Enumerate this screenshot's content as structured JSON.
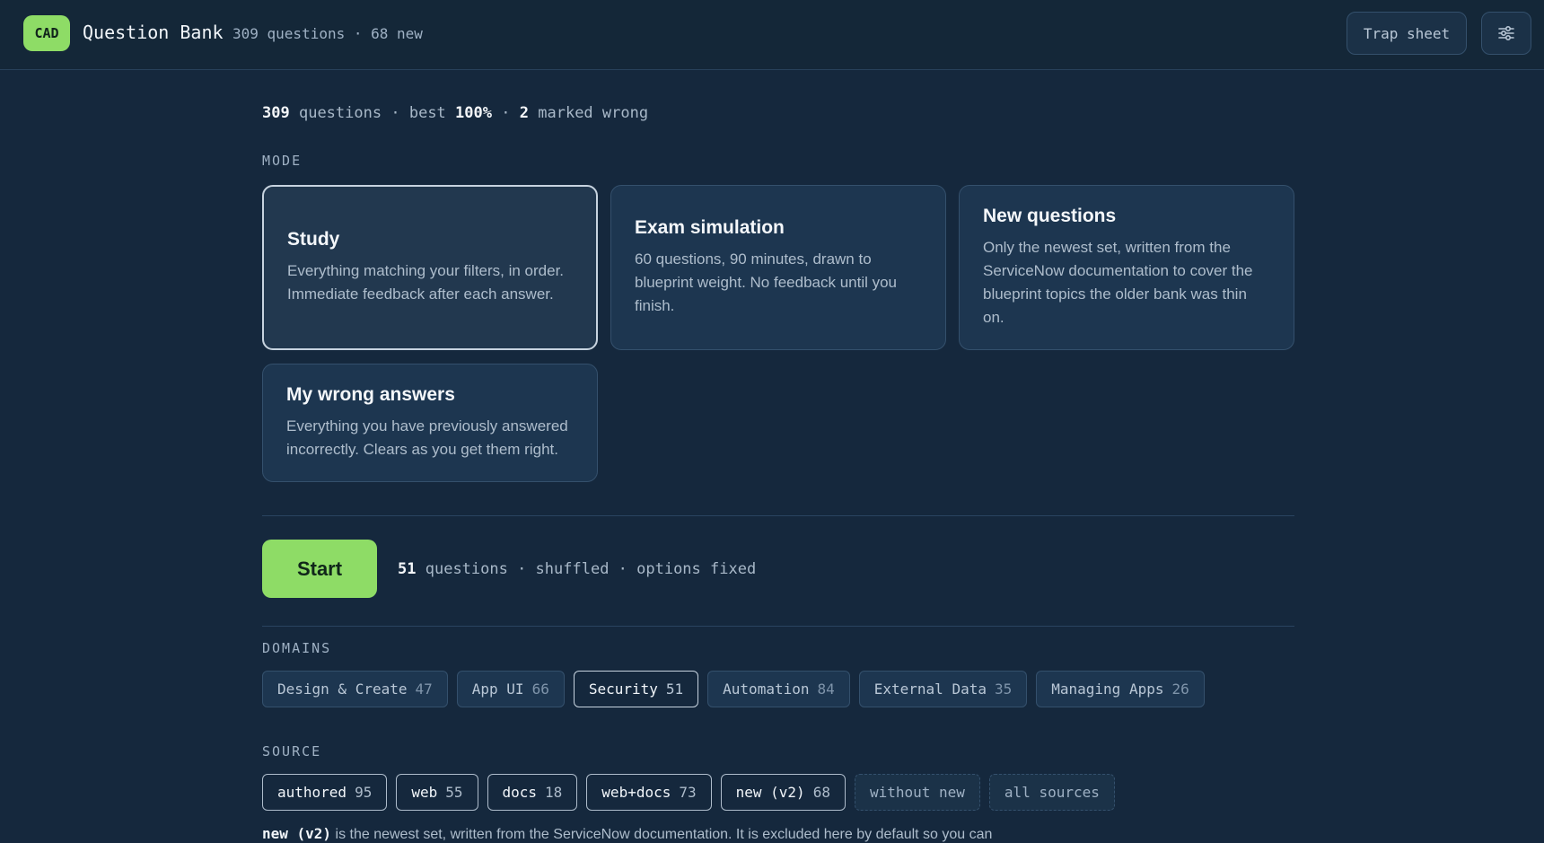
{
  "header": {
    "logo": "CAD",
    "title": "Question Bank",
    "subtitle": "309 questions · 68 new",
    "trap_sheet": "Trap sheet",
    "settings_icon": "sliders-icon"
  },
  "stats": {
    "questions_count": "309",
    "questions_label": "questions",
    "sep1": "·",
    "best_label": "best",
    "best_value": "100%",
    "sep2": "·",
    "wrong_count": "2",
    "wrong_label": "marked wrong"
  },
  "mode": {
    "label": "MODE",
    "cards": [
      {
        "title": "Study",
        "desc": "Everything matching your filters, in order. Immediate feedback after each answer.",
        "selected": true
      },
      {
        "title": "Exam simulation",
        "desc": "60 questions, 90 minutes, drawn to blueprint weight. No feedback until you finish.",
        "selected": false
      },
      {
        "title": "New questions",
        "desc": "Only the newest set, written from the ServiceNow documentation to cover the blueprint topics the older bank was thin on.",
        "selected": false
      },
      {
        "title": "My wrong answers",
        "desc": "Everything you have previously answered incorrectly. Clears as you get them right.",
        "selected": false
      }
    ]
  },
  "start": {
    "label": "Start",
    "count": "51",
    "info": "questions · shuffled · options fixed"
  },
  "domains": {
    "label": "DOMAINS",
    "chips": [
      {
        "name": "Design & Create",
        "count": "47",
        "active": false
      },
      {
        "name": "App UI",
        "count": "66",
        "active": false
      },
      {
        "name": "Security",
        "count": "51",
        "active": true
      },
      {
        "name": "Automation",
        "count": "84",
        "active": false
      },
      {
        "name": "External Data",
        "count": "35",
        "active": false
      },
      {
        "name": "Managing Apps",
        "count": "26",
        "active": false
      }
    ]
  },
  "source": {
    "label": "SOURCE",
    "chips": [
      {
        "name": "authored",
        "count": "95"
      },
      {
        "name": "web",
        "count": "55"
      },
      {
        "name": "docs",
        "count": "18"
      },
      {
        "name": "web+docs",
        "count": "73"
      },
      {
        "name": "new (v2)",
        "count": "68"
      }
    ],
    "extra": [
      "without new",
      "all sources"
    ],
    "note_bold": "new (v2)",
    "note_text": " is the newest set, written from the ServiceNow documentation. It is excluded here by default so you can"
  }
}
